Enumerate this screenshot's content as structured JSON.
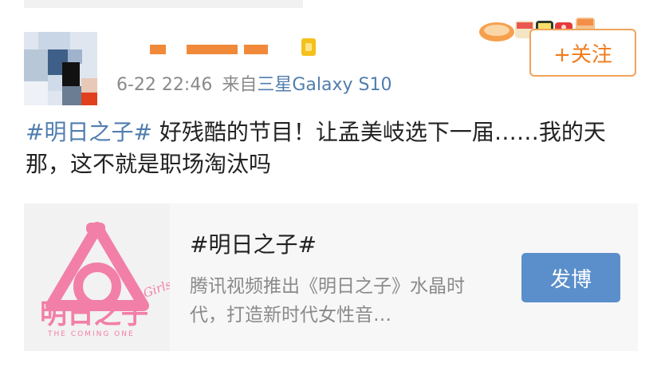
{
  "post": {
    "username_hidden": true,
    "date": "6-22 22:46",
    "source_prefix": "来自",
    "device": "三星Galaxy S10",
    "hashtag": "#明日之子#",
    "body": " 好残酷的节目！让孟美岐选下一届……我的天那，这不就是职场淘汰吗",
    "follow_label": "+关注"
  },
  "card": {
    "title": "#明日之子#",
    "description": "腾讯视频推出《明日之子》水晶时代，打造新时代女性音…",
    "button_label": "发博",
    "logo_text": "明日之子",
    "logo_sub": "THE COMING ONE",
    "logo_script": "Girls"
  },
  "colors": {
    "link": "#507daf",
    "follow": "#f07b1c",
    "button": "#5b8fcb",
    "logo_pink": "#f27fa8"
  }
}
